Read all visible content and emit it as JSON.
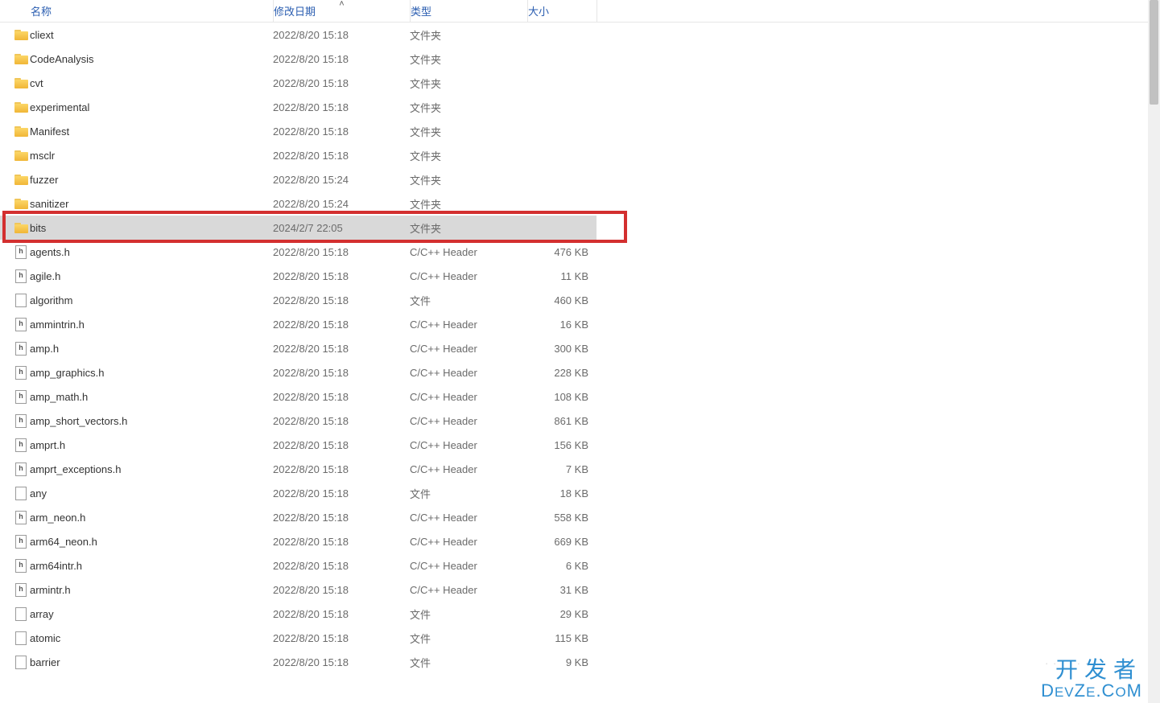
{
  "columns": {
    "name": "名称",
    "date": "修改日期",
    "type": "类型",
    "size": "大小",
    "sort_icon": "˄"
  },
  "folder_type": "文件夹",
  "file_type_plain": "文件",
  "file_type_header": "C/C++ Header",
  "rows": [
    {
      "icon": "folder",
      "name": "cliext",
      "date": "2022/8/20 15:18",
      "type": "文件夹",
      "size": ""
    },
    {
      "icon": "folder",
      "name": "CodeAnalysis",
      "date": "2022/8/20 15:18",
      "type": "文件夹",
      "size": ""
    },
    {
      "icon": "folder",
      "name": "cvt",
      "date": "2022/8/20 15:18",
      "type": "文件夹",
      "size": ""
    },
    {
      "icon": "folder",
      "name": "experimental",
      "date": "2022/8/20 15:18",
      "type": "文件夹",
      "size": ""
    },
    {
      "icon": "folder",
      "name": "Manifest",
      "date": "2022/8/20 15:18",
      "type": "文件夹",
      "size": ""
    },
    {
      "icon": "folder",
      "name": "msclr",
      "date": "2022/8/20 15:18",
      "type": "文件夹",
      "size": ""
    },
    {
      "icon": "folder",
      "name": "fuzzer",
      "date": "2022/8/20 15:24",
      "type": "文件夹",
      "size": ""
    },
    {
      "icon": "folder",
      "name": "sanitizer",
      "date": "2022/8/20 15:24",
      "type": "文件夹",
      "size": ""
    },
    {
      "icon": "folder",
      "name": "bits",
      "date": "2024/2/7 22:05",
      "type": "文件夹",
      "size": "",
      "selected": true
    },
    {
      "icon": "hfile",
      "name": "agents.h",
      "date": "2022/8/20 15:18",
      "type": "C/C++ Header",
      "size": "476 KB"
    },
    {
      "icon": "hfile",
      "name": "agile.h",
      "date": "2022/8/20 15:18",
      "type": "C/C++ Header",
      "size": "11 KB"
    },
    {
      "icon": "file",
      "name": "algorithm",
      "date": "2022/8/20 15:18",
      "type": "文件",
      "size": "460 KB"
    },
    {
      "icon": "hfile",
      "name": "ammintrin.h",
      "date": "2022/8/20 15:18",
      "type": "C/C++ Header",
      "size": "16 KB"
    },
    {
      "icon": "hfile",
      "name": "amp.h",
      "date": "2022/8/20 15:18",
      "type": "C/C++ Header",
      "size": "300 KB"
    },
    {
      "icon": "hfile",
      "name": "amp_graphics.h",
      "date": "2022/8/20 15:18",
      "type": "C/C++ Header",
      "size": "228 KB"
    },
    {
      "icon": "hfile",
      "name": "amp_math.h",
      "date": "2022/8/20 15:18",
      "type": "C/C++ Header",
      "size": "108 KB"
    },
    {
      "icon": "hfile",
      "name": "amp_short_vectors.h",
      "date": "2022/8/20 15:18",
      "type": "C/C++ Header",
      "size": "861 KB"
    },
    {
      "icon": "hfile",
      "name": "amprt.h",
      "date": "2022/8/20 15:18",
      "type": "C/C++ Header",
      "size": "156 KB"
    },
    {
      "icon": "hfile",
      "name": "amprt_exceptions.h",
      "date": "2022/8/20 15:18",
      "type": "C/C++ Header",
      "size": "7 KB"
    },
    {
      "icon": "file",
      "name": "any",
      "date": "2022/8/20 15:18",
      "type": "文件",
      "size": "18 KB"
    },
    {
      "icon": "hfile",
      "name": "arm_neon.h",
      "date": "2022/8/20 15:18",
      "type": "C/C++ Header",
      "size": "558 KB"
    },
    {
      "icon": "hfile",
      "name": "arm64_neon.h",
      "date": "2022/8/20 15:18",
      "type": "C/C++ Header",
      "size": "669 KB"
    },
    {
      "icon": "hfile",
      "name": "arm64intr.h",
      "date": "2022/8/20 15:18",
      "type": "C/C++ Header",
      "size": "6 KB"
    },
    {
      "icon": "hfile",
      "name": "armintr.h",
      "date": "2022/8/20 15:18",
      "type": "C/C++ Header",
      "size": "31 KB"
    },
    {
      "icon": "file",
      "name": "array",
      "date": "2022/8/20 15:18",
      "type": "文件",
      "size": "29 KB"
    },
    {
      "icon": "file",
      "name": "atomic",
      "date": "2022/8/20 15:18",
      "type": "文件",
      "size": "115 KB"
    },
    {
      "icon": "file",
      "name": "barrier",
      "date": "2022/8/20 15:18",
      "type": "文件",
      "size": "9 KB"
    }
  ],
  "highlight_row_index": 8,
  "watermark": {
    "line1": "开发者",
    "line2_a": "D",
    "line2_b": "EV",
    "line2_c": "Z",
    "line2_d": "E",
    "line2_e": ".C",
    "line2_f": "O",
    "line2_g": "M"
  }
}
